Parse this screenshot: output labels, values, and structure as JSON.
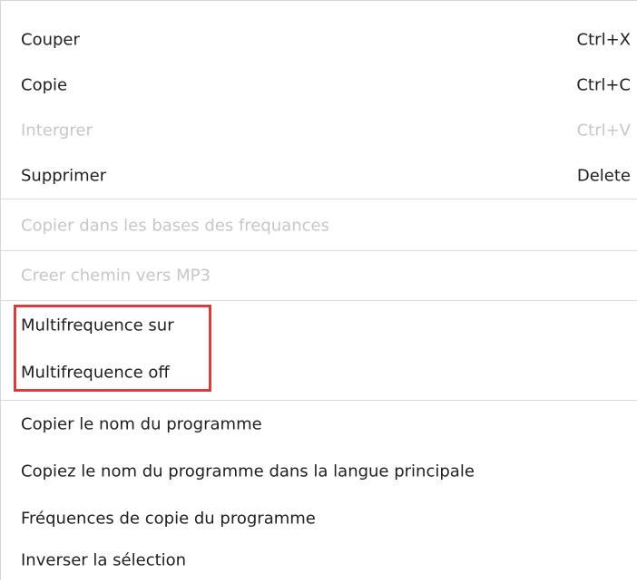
{
  "menu": {
    "items": [
      {
        "label": "Couper",
        "shortcut": "Ctrl+X"
      },
      {
        "label": "Copie",
        "shortcut": "Ctrl+C"
      },
      {
        "label": "Intergrer",
        "shortcut": "Ctrl+V",
        "disabled": true
      },
      {
        "label": "Supprimer",
        "shortcut": "Delete"
      },
      {
        "label": "Copier dans les bases des frequances",
        "disabled": true
      },
      {
        "label": "Creer chemin vers MP3",
        "disabled": true
      },
      {
        "label": "Multifrequence sur"
      },
      {
        "label": "Multifrequence off"
      },
      {
        "label": "Copier le nom du programme"
      },
      {
        "label": "Copiez le nom du programme dans la langue principale"
      },
      {
        "label": "Fréquences de copie du programme"
      },
      {
        "label": "Inverser la sélection"
      }
    ]
  },
  "colors": {
    "text": "#1f1f1f",
    "disabled_text": "#c7c7c7",
    "separator": "#d9d9d9",
    "highlight": "#d73d3d"
  }
}
